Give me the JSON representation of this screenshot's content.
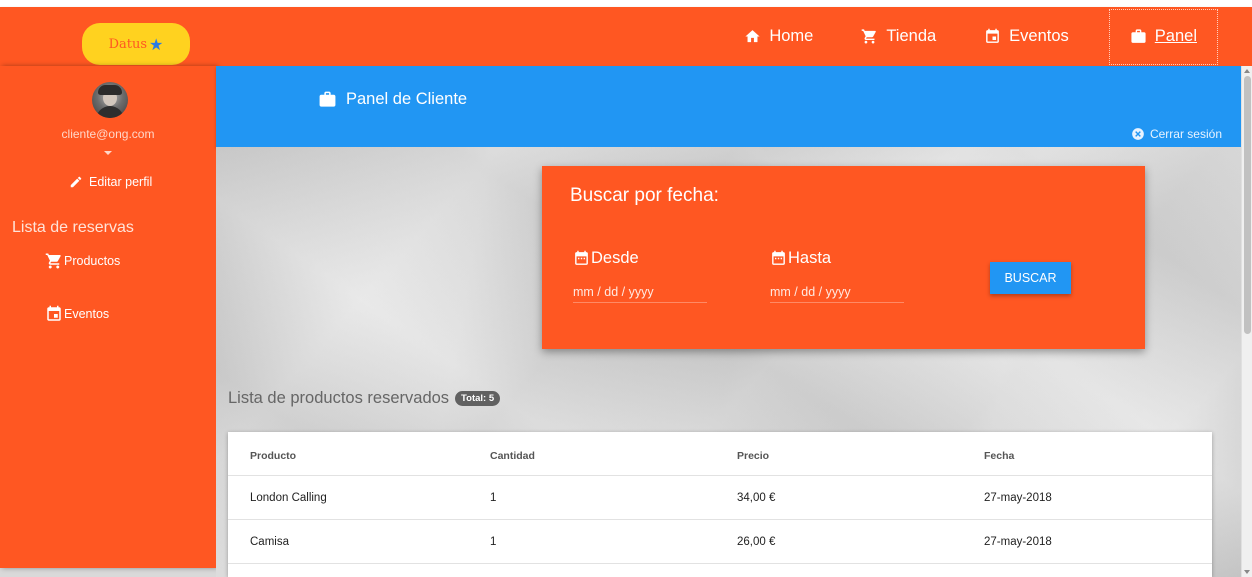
{
  "brand": {
    "logo_text": "Datus"
  },
  "nav": {
    "items": [
      {
        "label": "Home",
        "icon": "home-icon"
      },
      {
        "label": "Tienda",
        "icon": "cart-icon"
      },
      {
        "label": "Eventos",
        "icon": "calendar-icon"
      },
      {
        "label": "Panel",
        "icon": "briefcase-icon",
        "active": true
      }
    ]
  },
  "sidebar": {
    "email": "cliente@ong.com",
    "edit_label": "Editar perfil",
    "list_title": "Lista de reservas",
    "items": [
      {
        "label": "Productos",
        "icon": "cart-icon"
      },
      {
        "label": "Eventos",
        "icon": "calendar-icon"
      }
    ]
  },
  "header": {
    "title": "Panel de Cliente",
    "logout": "Cerrar sesión"
  },
  "search": {
    "heading": "Buscar por fecha:",
    "from_label": "Desde",
    "to_label": "Hasta",
    "date_placeholder": "mm / dd / yyyy",
    "button": "BUSCAR"
  },
  "products": {
    "title": "Lista de productos reservados",
    "total_badge": "Total: 5",
    "columns": [
      "Producto",
      "Cantidad",
      "Precio",
      "Fecha"
    ],
    "rows": [
      [
        "London Calling",
        "1",
        "34,00 €",
        "27-may-2018"
      ],
      [
        "Camisa",
        "1",
        "26,00 €",
        "27-may-2018"
      ]
    ]
  },
  "colors": {
    "primary": "#ff5722",
    "accent": "#2196f3",
    "badge": "#616161"
  }
}
